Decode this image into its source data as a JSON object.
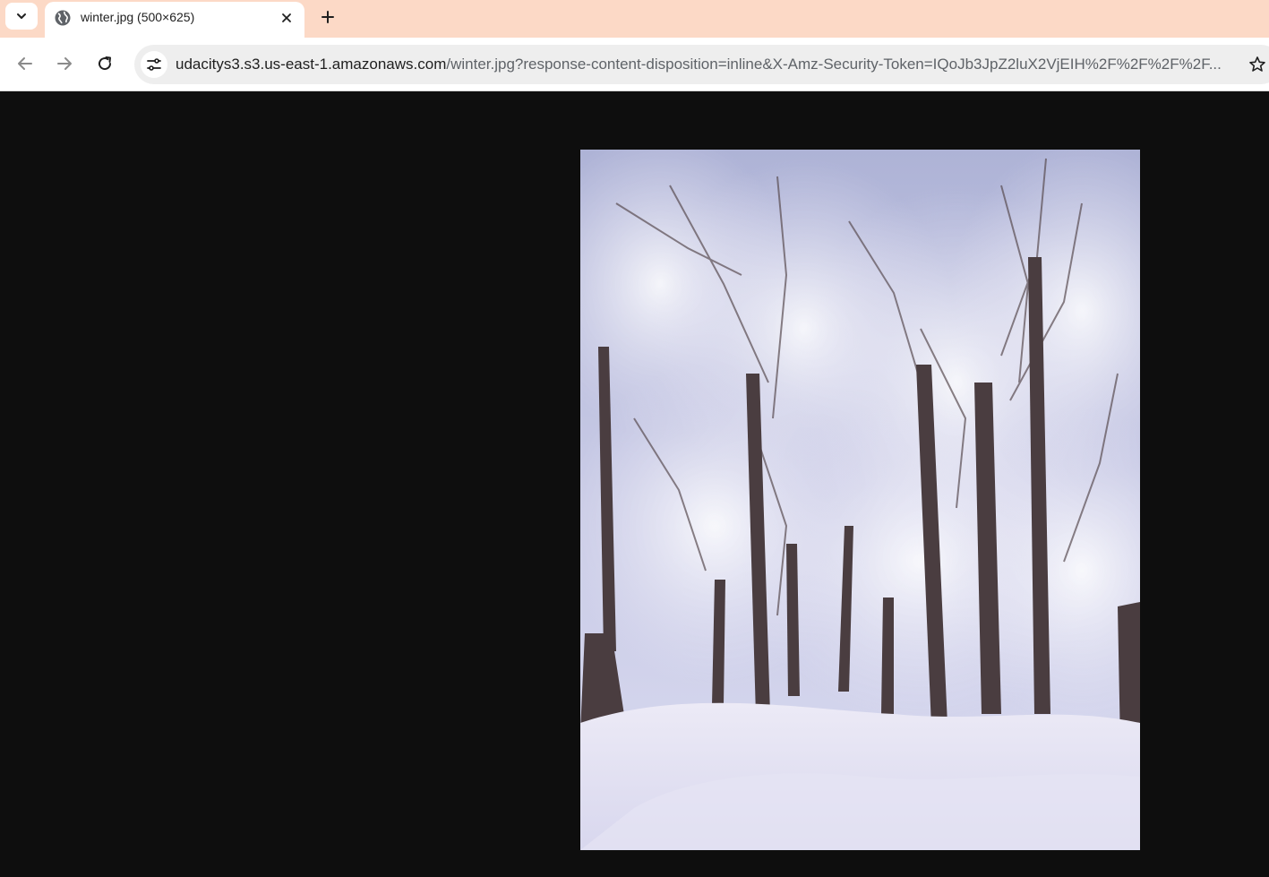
{
  "browser": {
    "tab": {
      "title": "winter.jpg (500×625)",
      "favicon": "globe-icon"
    },
    "tab_search_icon": "chevron-down-icon",
    "close_icon": "close-icon",
    "new_tab_icon": "plus-icon",
    "toolbar": {
      "back_icon": "arrow-left-icon",
      "forward_icon": "arrow-right-icon",
      "reload_icon": "reload-icon",
      "site_info_icon": "tune-icon",
      "bookmark_icon": "star-icon"
    },
    "url": {
      "host": "udacitys3.s3.us-east-1.amazonaws.com",
      "path": "/winter.jpg?response-content-disposition=inline&X-Amz-Security-Token=IQoJb3JpZ2luX2VjEIH%2F%2F%2F%2F..."
    }
  },
  "viewer": {
    "image_alt": "winter.jpg",
    "image_subject": "snow-covered-trees"
  },
  "colors": {
    "tabstrip": "#fcd9c6",
    "viewer_bg": "#0e0e0e",
    "omnibox": "#eeeeee"
  }
}
